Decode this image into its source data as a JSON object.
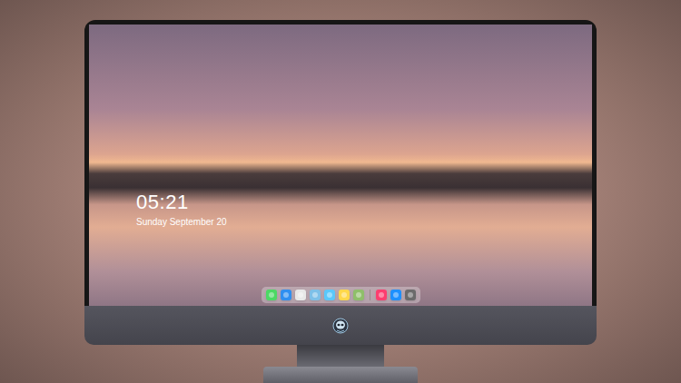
{
  "clock": {
    "time": "05:21",
    "date": "Sunday September 20"
  },
  "dock": {
    "items": [
      {
        "kind": "app",
        "color": "#4cd964"
      },
      {
        "kind": "app",
        "color": "#2f8ff0"
      },
      {
        "kind": "app",
        "color": "#e8e8e8"
      },
      {
        "kind": "app",
        "color": "#7ec0e8"
      },
      {
        "kind": "app",
        "color": "#5ac8fa"
      },
      {
        "kind": "app",
        "color": "#ffd84a"
      },
      {
        "kind": "app",
        "color": "#8fbf6a"
      },
      {
        "kind": "separator",
        "color": "#9a8a8a"
      },
      {
        "kind": "app",
        "color": "#fc3d6f"
      },
      {
        "kind": "app",
        "color": "#1e90ff"
      },
      {
        "kind": "app",
        "color": "#6b6b6b"
      }
    ]
  }
}
